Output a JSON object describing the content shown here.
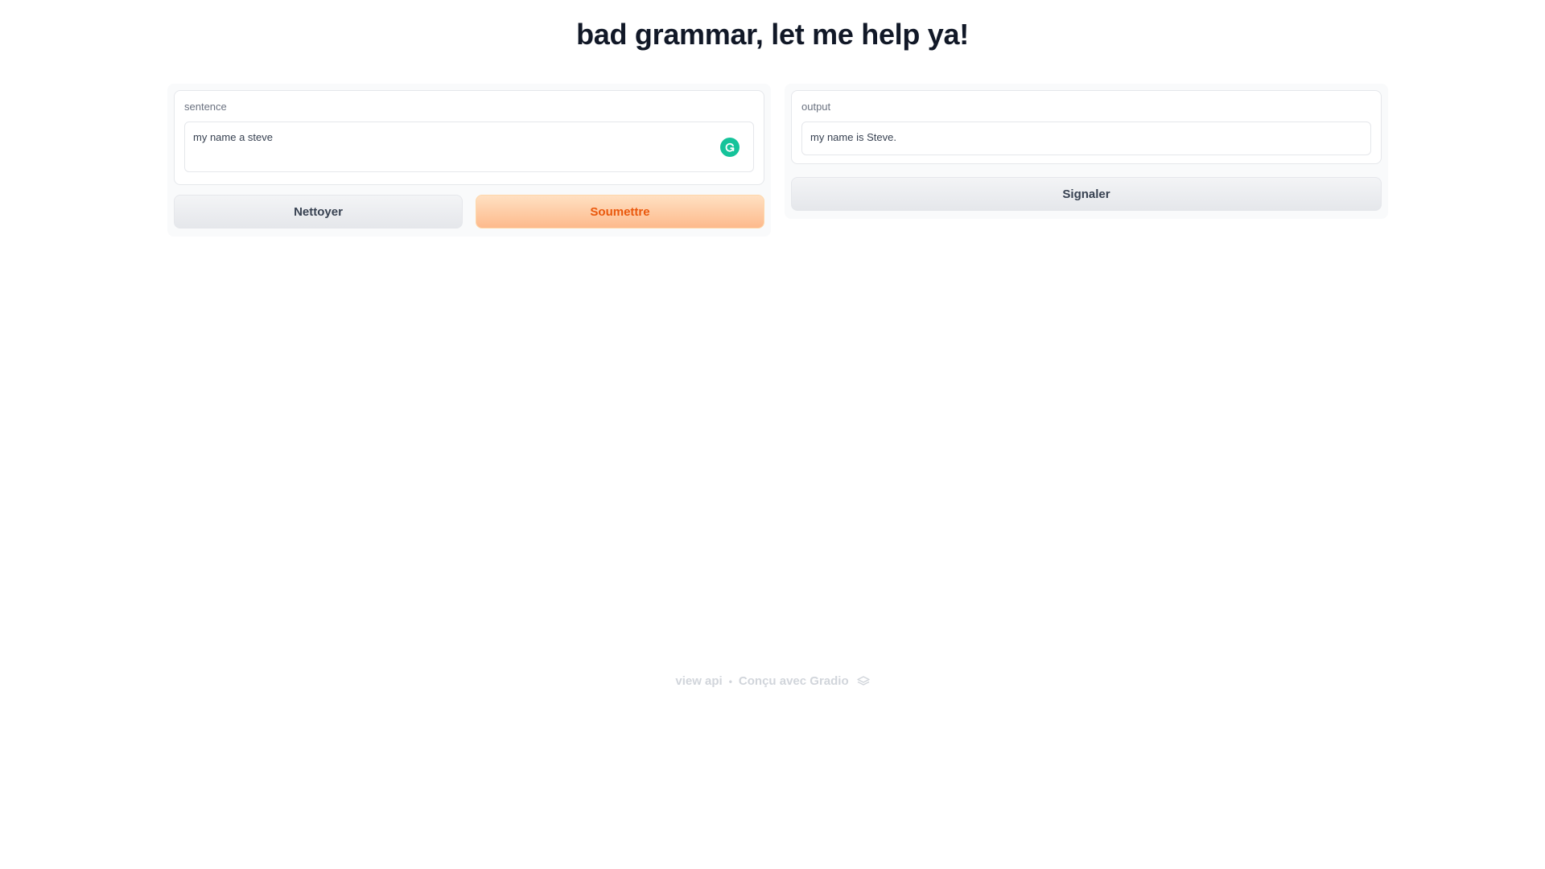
{
  "app": {
    "title": "bad grammar, let me help ya!"
  },
  "input": {
    "label": "sentence",
    "value": "my name a steve",
    "extension_icon": "grammarly-icon"
  },
  "buttons": {
    "clear_label": "Nettoyer",
    "submit_label": "Soumettre",
    "flag_label": "Signaler"
  },
  "output": {
    "label": "output",
    "value": "my name is Steve."
  },
  "footer": {
    "api_link": "view api",
    "separator": "•",
    "built_with": "Conçu avec Gradio",
    "logo_icon": "gradio-logo-icon"
  },
  "colors": {
    "accent": "#ea580c",
    "primary_button_bg": "#fdba8c",
    "grammarly": "#15c39a"
  }
}
